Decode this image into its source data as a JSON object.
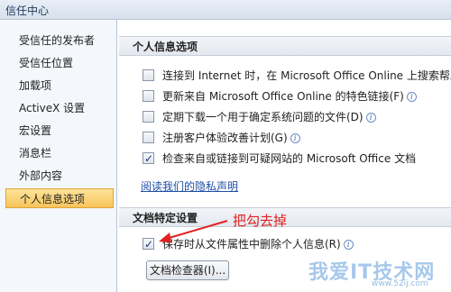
{
  "window": {
    "title": "信任中心"
  },
  "sidebar": {
    "items": [
      {
        "label": "受信任的发布者",
        "active": false
      },
      {
        "label": "受信任位置",
        "active": false
      },
      {
        "label": "加载项",
        "active": false
      },
      {
        "label": "ActiveX 设置",
        "active": false
      },
      {
        "label": "宏设置",
        "active": false
      },
      {
        "label": "消息栏",
        "active": false
      },
      {
        "label": "外部内容",
        "active": false
      },
      {
        "label": "个人信息选项",
        "active": true
      }
    ]
  },
  "personal_info": {
    "heading": "个人信息选项",
    "options": [
      {
        "label": "连接到 Internet 时，在 Microsoft Office Online 上搜索帮助内",
        "checked": false,
        "info": false
      },
      {
        "label": "更新来自 Microsoft Office Online 的特色链接(F)",
        "checked": false,
        "info": true
      },
      {
        "label": "定期下载一个用于确定系统问题的文件(D)",
        "checked": false,
        "info": true
      },
      {
        "label": "注册客户体验改善计划(G)",
        "checked": false,
        "info": true
      },
      {
        "label": "检查来自或链接到可疑网站的 Microsoft Office 文档",
        "checked": true,
        "info": false
      }
    ],
    "privacy_link": "阅读我们的隐私声明"
  },
  "document_settings": {
    "heading": "文档特定设置",
    "remove_personal_info": {
      "label": "保存时从文件属性中删除个人信息(R)",
      "checked": true,
      "info": true
    },
    "inspector_button": "文档检查器(I)..."
  },
  "annotation": {
    "text": "把勾去掉",
    "color": "#e12222"
  },
  "watermark": {
    "text": "我爱IT技术网",
    "sub": "www.52ij.com"
  },
  "colors": {
    "accent": "#f7c55b",
    "link": "#1f4fa8"
  }
}
